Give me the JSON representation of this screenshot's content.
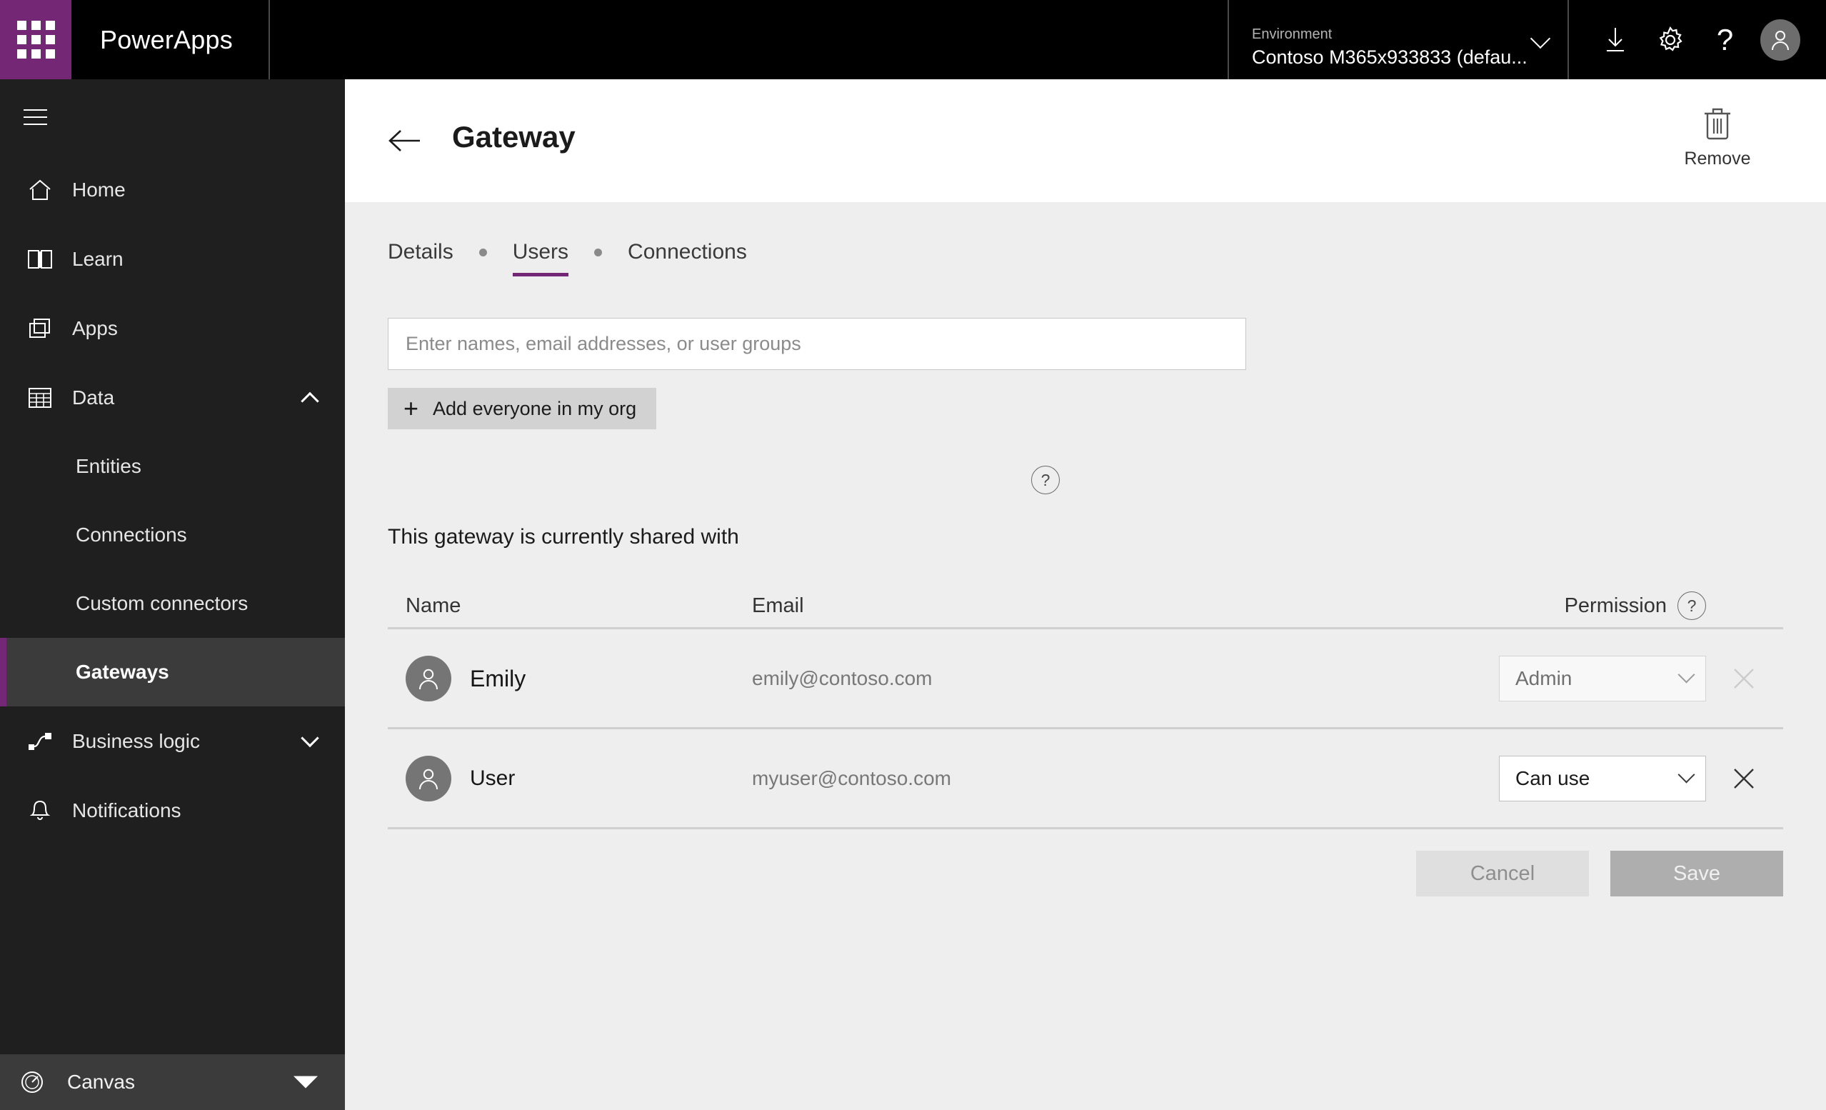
{
  "topbar": {
    "waffle_icon": "app-launcher-grid-icon",
    "brand": "PowerApps",
    "environment_label": "Environment",
    "environment_value": "Contoso M365x933833 (defau...",
    "icons": {
      "download": "download-icon",
      "settings": "gear-icon",
      "help": "?",
      "account": "user-avatar-icon"
    }
  },
  "sidebar": {
    "menu_toggle": "hamburger-menu-icon",
    "items": [
      {
        "label": "Home",
        "icon": "home-icon"
      },
      {
        "label": "Learn",
        "icon": "book-icon"
      },
      {
        "label": "Apps",
        "icon": "apps-stack-icon"
      },
      {
        "label": "Data",
        "icon": "table-grid-icon",
        "expanded": true
      }
    ],
    "data_children": [
      {
        "label": "Entities",
        "selected": false
      },
      {
        "label": "Connections",
        "selected": false
      },
      {
        "label": "Custom connectors",
        "selected": false
      },
      {
        "label": "Gateways",
        "selected": true
      }
    ],
    "items_after": [
      {
        "label": "Business logic",
        "icon": "flow-icon",
        "expanded": false
      },
      {
        "label": "Notifications",
        "icon": "bell-icon"
      }
    ],
    "footer": {
      "label": "Canvas",
      "icon": "gauge-icon"
    },
    "accent_color": "#742774",
    "selected_bg": "#3b3b3b"
  },
  "page": {
    "title": "Gateway",
    "back_icon": "back-arrow-icon",
    "remove": {
      "label": "Remove",
      "icon": "trash-icon"
    }
  },
  "tabs": [
    {
      "label": "Details",
      "active": false
    },
    {
      "label": "Users",
      "active": true
    },
    {
      "label": "Connections",
      "active": false
    }
  ],
  "share": {
    "input_placeholder": "Enter names, email addresses, or user groups",
    "input_value": "",
    "add_everyone_label": "Add everyone in my org",
    "add_everyone_plus": "+",
    "help_glyph": "?",
    "shared_with_text": "This gateway is currently shared with"
  },
  "table": {
    "headers": {
      "name": "Name",
      "email": "Email",
      "permission": "Permission"
    },
    "permission_help_glyph": "?",
    "rows": [
      {
        "name": "Emily",
        "email": "emily@contoso.com",
        "permission": "Admin",
        "permission_disabled": true,
        "remove_disabled": true,
        "avatar_icon": "person-avatar-icon"
      },
      {
        "name": "User",
        "email": "myuser@contoso.com",
        "permission": "Can use",
        "permission_disabled": false,
        "remove_disabled": false,
        "avatar_icon": "person-avatar-icon"
      }
    ]
  },
  "actions": {
    "cancel_label": "Cancel",
    "save_label": "Save"
  }
}
